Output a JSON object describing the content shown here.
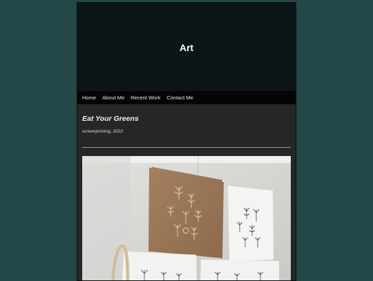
{
  "site": {
    "title": "Art"
  },
  "nav": {
    "items": [
      "Home",
      "About Me",
      "Recent Work",
      "Contact Me"
    ]
  },
  "post": {
    "title": "Eat Your Greens",
    "meta": "screenprinting, 2022",
    "image_subject": "Screenprints of leafy plants pinned to a studio wall with a tote bag"
  },
  "colors": {
    "background": "#244848",
    "header": "#0b1517",
    "nav": "#050505",
    "content": "#262626"
  }
}
